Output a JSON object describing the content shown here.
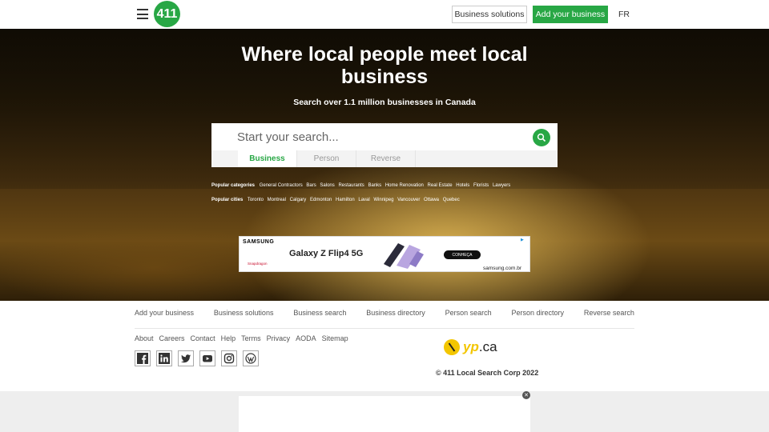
{
  "header": {
    "menu_icon": "hamburger-icon",
    "logo_text": "411",
    "business_solutions": "Business solutions",
    "add_business": "Add your business",
    "lang": "FR"
  },
  "hero": {
    "title": "Where local people meet local business",
    "subtitle": "Search over 1.1 million businesses in Canada",
    "search_placeholder": "Start your search...",
    "tabs": [
      "Business",
      "Person",
      "Reverse"
    ],
    "active_tab": "Business",
    "popular_categories_label": "Popular categories",
    "popular_categories": [
      "General Contractors",
      "Bars",
      "Salons",
      "Restaurants",
      "Banks",
      "Home Renovation",
      "Real Estate",
      "Hotels",
      "Florists",
      "Lawyers"
    ],
    "popular_cities_label": "Popular cities",
    "popular_cities": [
      "Toronto",
      "Montreal",
      "Calgary",
      "Edmonton",
      "Hamilton",
      "Laval",
      "Winnipeg",
      "Vancouver",
      "Ottawa",
      "Quebec"
    ]
  },
  "ad": {
    "brand": "SAMSUNG",
    "title": "Galaxy Z Flip4 5G",
    "cta": "CONHEÇA",
    "sponsor": "Snapdragon",
    "domain": "samsung.com.br"
  },
  "footer": {
    "links": [
      "Add your business",
      "Business solutions",
      "Business search",
      "Business directory",
      "Person search",
      "Person directory",
      "Reverse search"
    ],
    "small_links": [
      "About",
      "Careers",
      "Contact",
      "Help",
      "Terms",
      "Privacy",
      "AODA",
      "Sitemap"
    ],
    "social": [
      "facebook-icon",
      "linkedin-icon",
      "twitter-icon",
      "youtube-icon",
      "instagram-icon",
      "wordpress-icon"
    ],
    "yp_brand": "yp",
    "yp_tld": ".ca",
    "copyright": "© 411 Local Search Corp 2022"
  },
  "colors": {
    "accent": "#28a745",
    "yp_yellow": "#f3c600"
  }
}
